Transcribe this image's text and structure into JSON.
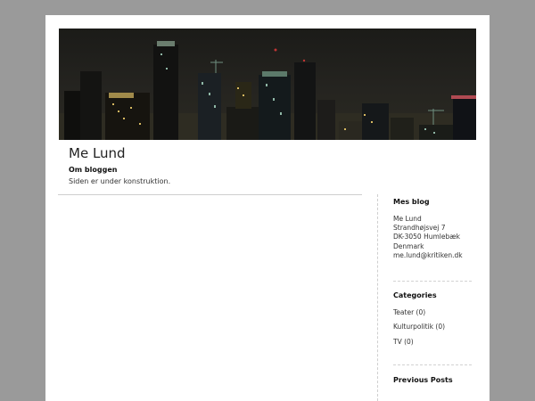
{
  "site": {
    "title": "Me Lund",
    "about_heading": "Om bloggen",
    "about_text": "Siden er under konstruktion."
  },
  "sidebar": {
    "contact": {
      "title": "Mes blog",
      "lines": [
        "Me Lund",
        "Strandhøjsvej 7",
        "DK-3050 Humlebæk",
        "Denmark",
        "me.lund@kritiken.dk"
      ]
    },
    "categories": {
      "title": "Categories",
      "items": [
        "Teater (0)",
        "Kulturpolitik (0)",
        "TV (0)"
      ]
    },
    "previous_posts": {
      "title": "Previous Posts"
    }
  },
  "colors": {
    "background": "#9a9a9a",
    "page": "#ffffff",
    "text": "#333333"
  }
}
